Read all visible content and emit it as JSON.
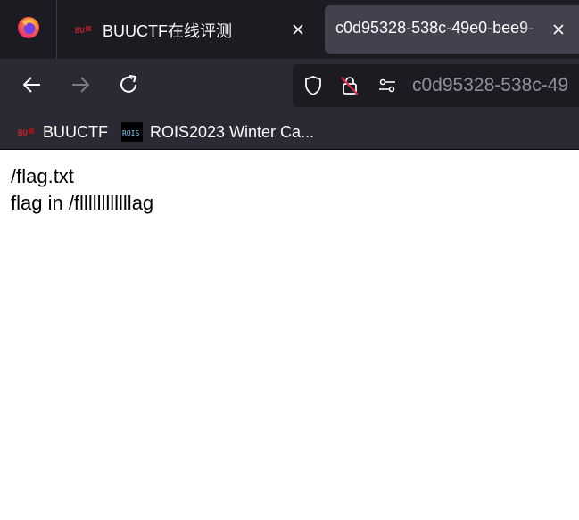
{
  "browser": {
    "icons": {
      "app": "firefox-logo-icon",
      "tab_close": "close-icon",
      "back": "back-arrow-icon",
      "forward": "forward-arrow-icon",
      "reload": "reload-icon",
      "tracking": "shield-icon",
      "security": "insecure-lock-icon",
      "permissions": "permissions-icon"
    },
    "colors": {
      "tab_strip_bg": "#1c1b22",
      "toolbar_bg": "#2b2a33",
      "active_tab_bg": "#42414d",
      "text": "#fbfbfe",
      "url_text": "#8f8f9d",
      "insecure_red": "#e22850"
    }
  },
  "tabs": [
    {
      "title": "BUUCTF在线评测",
      "active": false,
      "favicon": "buuctf-logo-icon"
    },
    {
      "title": "c0d95328-538c-49e0-bee9-",
      "active": true
    }
  ],
  "urlbar": {
    "text": "c0d95328-538c-49"
  },
  "bookmarks": [
    {
      "label": "BUUCTF",
      "icon": "buuctf-logo-icon"
    },
    {
      "label": "ROIS2023 Winter Ca...",
      "icon": "rois-logo-icon",
      "icon_text": "ROIS"
    }
  ],
  "page": {
    "lines": [
      "/flag.txt",
      "flag in /fllllllllllllag"
    ]
  }
}
